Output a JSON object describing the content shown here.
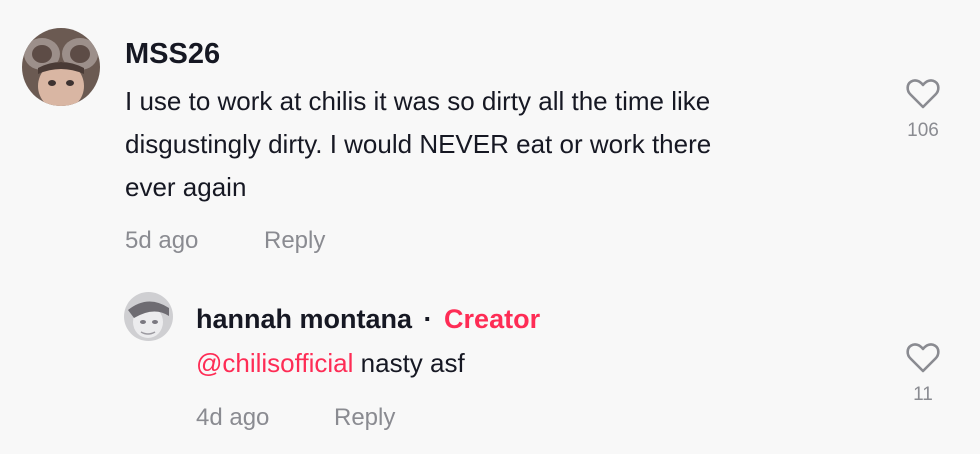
{
  "comment": {
    "username": "MSS26",
    "text_lines": [
      "I use to work at chilis it was so dirty all the time like",
      "disgustingly dirty. I would NEVER eat or work there",
      "ever again"
    ],
    "time": "5d ago",
    "reply_label": "Reply",
    "like_count": "106",
    "avatar_icon": "user-photo-avatar",
    "like_icon": "heart-outline-icon"
  },
  "reply": {
    "username": "hannah montana",
    "separator": "·",
    "badge": "Creator",
    "mention": "@chilisofficial",
    "text": " nasty asf",
    "time": "4d ago",
    "reply_label": "Reply",
    "like_count": "11",
    "avatar_icon": "user-photo-avatar",
    "like_icon": "heart-outline-icon"
  },
  "colors": {
    "accent": "#fe2c55",
    "text": "#161823",
    "muted": "#8a8b91",
    "background": "#f8f8f8"
  }
}
